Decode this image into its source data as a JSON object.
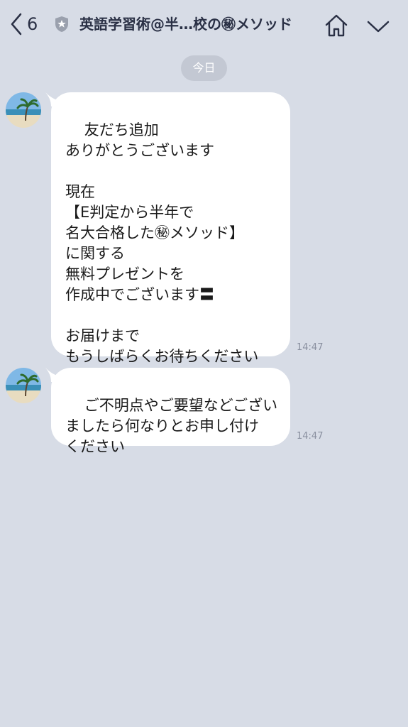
{
  "header": {
    "unread_count": "6",
    "title": "英語学習術@半…校の㊙メソッド"
  },
  "chat": {
    "date_label": "今日",
    "messages": [
      {
        "text": "友だち追加\nありがとうございます\n\n現在\n【E判定から半年で\n名大合格した㊙メソッド】\nに関する\n無料プレゼントを\n作成中でございます〓\n\nお届けまで\nもうしばらくお待ちください",
        "time": "14:47"
      },
      {
        "text": "ご不明点やご要望などござい\nましたら何なりとお申し付け\nください",
        "time": "14:47"
      }
    ]
  },
  "colors": {
    "background": "#d7dce6",
    "bubble": "#ffffff",
    "header_text": "#2a3045",
    "date_pill": "#c3c8d3",
    "timestamp": "#8a90a0"
  },
  "icons": {
    "back": "chevron-left-icon",
    "badge": "shield-star-icon",
    "home": "home-icon",
    "menu": "chevron-down-icon",
    "avatar": "beach-palm-avatar"
  }
}
